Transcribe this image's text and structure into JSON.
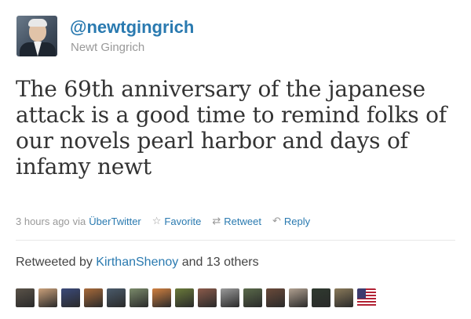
{
  "tweet": {
    "screen_name": "@newtgingrich",
    "full_name": "Newt Gingrich",
    "text": "The 69th anniversary of the japanese attack is a good time to remind folks of our novels pearl harbor and days of infamy newt",
    "timestamp": "3 hours ago",
    "via_label": "via",
    "source": "ÜberTwitter",
    "actions": {
      "favorite": "Favorite",
      "retweet": "Retweet",
      "reply": "Reply"
    },
    "icons": {
      "favorite": "star-icon",
      "retweet": "retweet-icon",
      "reply": "reply-icon"
    }
  },
  "retweets": {
    "prefix": "Retweeted by",
    "user": "KirthanShenoy",
    "suffix": "and 13 others",
    "avatars": [
      {
        "name": "retweeter-avatar",
        "color": "#5a5248"
      },
      {
        "name": "retweeter-avatar",
        "color": "#c9a07a"
      },
      {
        "name": "retweeter-avatar",
        "color": "#3b4a7a"
      },
      {
        "name": "retweeter-avatar",
        "color": "#a86a3a"
      },
      {
        "name": "retweeter-avatar",
        "color": "#4a5a6a"
      },
      {
        "name": "retweeter-avatar",
        "color": "#7a8a6a"
      },
      {
        "name": "retweeter-avatar",
        "color": "#d08040"
      },
      {
        "name": "retweeter-avatar",
        "color": "#6a7a3a"
      },
      {
        "name": "retweeter-avatar",
        "color": "#8a5a4a"
      },
      {
        "name": "retweeter-avatar",
        "color": "#9a9a9a"
      },
      {
        "name": "retweeter-avatar",
        "color": "#5a6a4a"
      },
      {
        "name": "retweeter-avatar",
        "color": "#6a4a3a"
      },
      {
        "name": "retweeter-avatar",
        "color": "#b0a090"
      },
      {
        "name": "retweeter-avatar",
        "color": "#2f3a2f"
      },
      {
        "name": "retweeter-avatar",
        "color": "#8a7a5a"
      },
      {
        "name": "retweeter-avatar-flag",
        "color": "#b22234",
        "flag": true
      }
    ]
  },
  "colors": {
    "link": "#2a7ab0",
    "muted": "#999999",
    "text": "#333333"
  }
}
